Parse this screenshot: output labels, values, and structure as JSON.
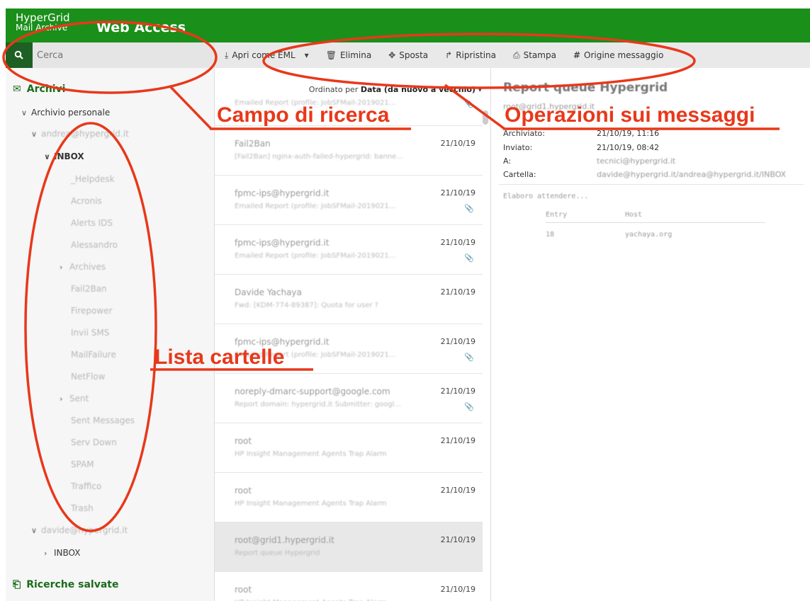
{
  "header": {
    "brand_line1": "HyperGrid",
    "brand_line2": "Mail Archive",
    "title": "Web Access"
  },
  "search": {
    "placeholder": "Cerca"
  },
  "toolbar": {
    "open_eml": "Apri come EML",
    "delete": "Elimina",
    "move": "Sposta",
    "restore": "Ripristina",
    "print": "Stampa",
    "source": "Origine messaggio"
  },
  "sidebar": {
    "archives_title": "Archivi",
    "personal_archive": "Archivio personale",
    "account1": "andrea@hypergrid.it",
    "inbox": "INBOX",
    "folders": [
      "_Helpdesk",
      "Acronis",
      "Alerts IDS",
      "Alessandro",
      "Archives",
      "Fail2Ban",
      "Firepower",
      "Invii SMS",
      "MailFailure",
      "NetFlow",
      "Sent",
      "Sent Messages",
      "Serv Down",
      "SPAM",
      "Traffico",
      "Trash"
    ],
    "account2": "davide@hypergrid.it",
    "inbox2": "INBOX",
    "saved_searches": "Ricerche salvate"
  },
  "list": {
    "sort_label": "Ordinato per",
    "sort_value": "Data (da nuovo a vecchio)",
    "messages": [
      {
        "from": "",
        "snippet": "Emailed Report (profile: JobSFMail-2019021...",
        "date": "",
        "clip": true
      },
      {
        "from": "Fail2Ban",
        "snippet": "[Fail2Ban] nginx-auth-failed-hypergrid: banne...",
        "date": "21/10/19",
        "clip": false
      },
      {
        "from": "fpmc-ips@hypergrid.it",
        "snippet": "Emailed Report (profile: JobSFMail-2019021...",
        "date": "21/10/19",
        "clip": true
      },
      {
        "from": "fpmc-ips@hypergrid.it",
        "snippet": "Emailed Report (profile: JobSFMail-2019021...",
        "date": "21/10/19",
        "clip": true
      },
      {
        "from": "Davide Yachaya",
        "snippet": "Fwd: [KDM-774-89387]: Quota for user ?",
        "date": "21/10/19",
        "clip": false
      },
      {
        "from": "fpmc-ips@hypergrid.it",
        "snippet": "Emailed Report (profile: JobSFMail-2019021...",
        "date": "21/10/19",
        "clip": true
      },
      {
        "from": "noreply-dmarc-support@google.com",
        "snippet": "Report domain: hypergrid.it Submitter: googl...",
        "date": "21/10/19",
        "clip": true
      },
      {
        "from": "root",
        "snippet": "HP Insight Management Agents Trap Alarm",
        "date": "21/10/19",
        "clip": false
      },
      {
        "from": "root",
        "snippet": "HP Insight Management Agents Trap Alarm",
        "date": "21/10/19",
        "clip": false
      },
      {
        "from": "root@grid1.hypergrid.it",
        "snippet": "Report queue Hypergrid",
        "date": "21/10/19",
        "clip": false
      },
      {
        "from": "root",
        "snippet": "HP Insight Management Agents Trap Alarm",
        "date": "21/10/19",
        "clip": false
      }
    ]
  },
  "reader": {
    "subject": "Report queue Hypergrid",
    "from": "root@grid1.hypergrid.it",
    "archived_label": "Archiviato:",
    "archived_value": "21/10/19, 11:16",
    "sent_label": "Inviato:",
    "sent_value": "21/10/19, 08:42",
    "to_label": "A:",
    "to_value": "tecnici@hypergrid.it",
    "folder_label": "Cartella:",
    "folder_value": "davide@hypergrid.it/andrea@hypergrid.it/INBOX",
    "body_line": "Elaboro attendere...",
    "col_entry": "Entry",
    "col_host": "Host",
    "row_entry": "18",
    "row_host": "yachaya.org"
  },
  "annotations": {
    "search_field": "Campo di ricerca",
    "message_ops": "Operazioni sui messaggi",
    "folder_list": "Lista cartelle",
    "color": "#e8381a"
  }
}
